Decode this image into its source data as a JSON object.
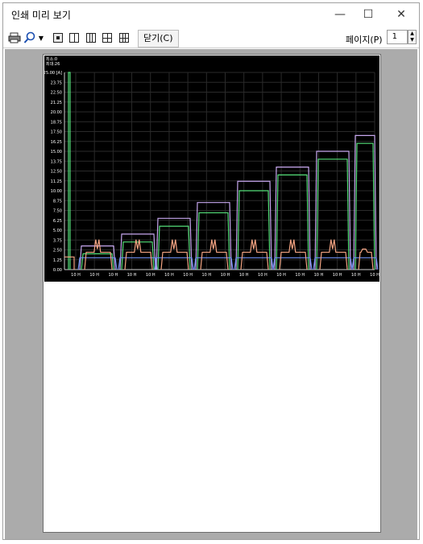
{
  "window": {
    "title": "인쇄 미리 보기",
    "minimize_glyph": "—",
    "maximize_glyph": "☐",
    "close_glyph": "✕"
  },
  "toolbar": {
    "print_icon": "printer-icon",
    "zoom_icon": "magnifier-icon",
    "close_label": "닫기(C)",
    "page_label": "페이지(P)",
    "page_value": "1"
  },
  "chart_data": {
    "type": "line",
    "background": "#000000",
    "top_labels": [
      "최소:0",
      "최대:26"
    ],
    "y_ticks": [
      "0.00",
      "1.25",
      "2.50",
      "3.75",
      "5.00",
      "6.25",
      "7.50",
      "8.75",
      "10.00",
      "11.25",
      "12.50",
      "13.75",
      "15.00",
      "16.25",
      "17.50",
      "18.75",
      "20.00",
      "21.25",
      "22.50",
      "23.75",
      "25.00"
    ],
    "y_unit": "[A]",
    "ylim": [
      0,
      25
    ],
    "x_tick_label": "10 H",
    "x_tick_count": 17,
    "series_colors": [
      "#55e07a",
      "#c7a8ef",
      "#f4a483",
      "#6f8ff0"
    ]
  }
}
